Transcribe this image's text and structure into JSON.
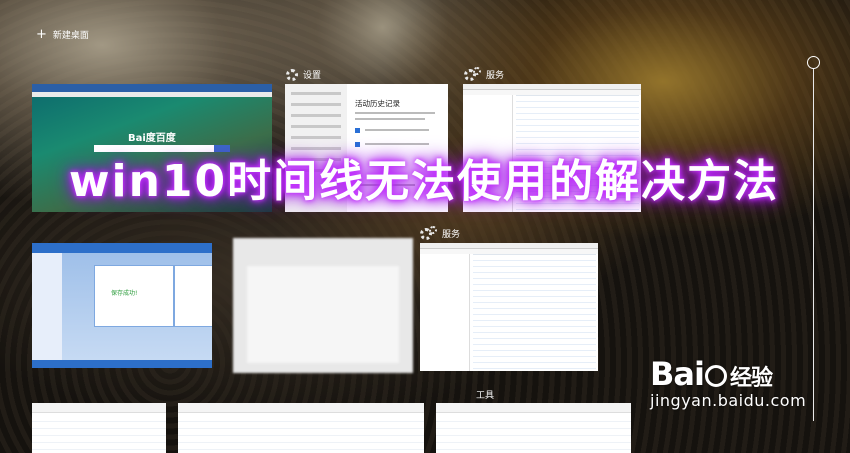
{
  "taskview": {
    "new_desktop_label": "新建桌面",
    "new_desktop_icon": "plus-icon"
  },
  "cards": {
    "settings_title": "设置",
    "services_title_1": "服务",
    "services_title_2": "服务",
    "tools_title": "工具"
  },
  "browser": {
    "logo_text": "Bai度百度"
  },
  "settings_window": {
    "heading": "活动历史记录"
  },
  "qq_window": {
    "status_text": "保存成功!"
  },
  "overlay": {
    "headline": "win10时间线无法使用的解决方法",
    "headline_glow_color": "#a000f0"
  },
  "watermark": {
    "brand_prefix": "Bai",
    "brand_suffix": "经验",
    "url": "jingyan.baidu.com"
  }
}
